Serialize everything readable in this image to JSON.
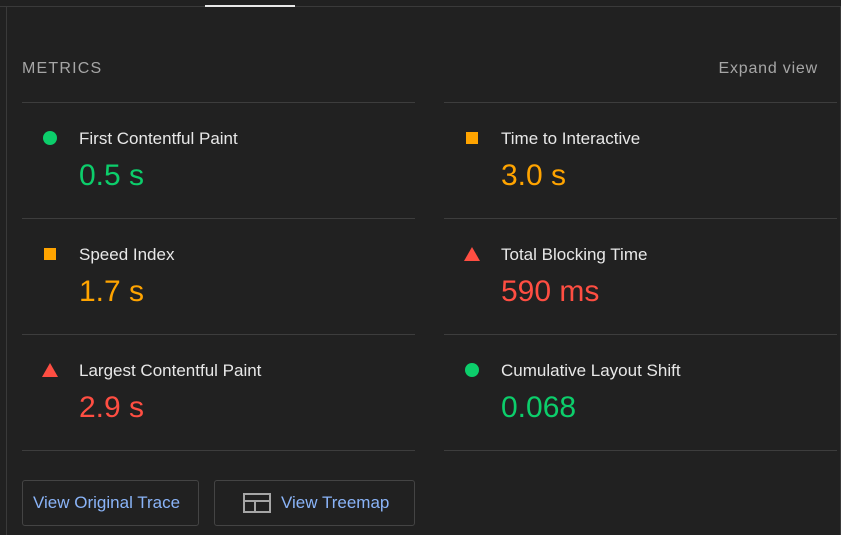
{
  "header": {
    "title": "METRICS",
    "expand_label": "Expand view"
  },
  "metrics": [
    {
      "title": "First Contentful Paint",
      "value": "0.5 s",
      "rating": "good"
    },
    {
      "title": "Time to Interactive",
      "value": "3.0 s",
      "rating": "average"
    },
    {
      "title": "Speed Index",
      "value": "1.7 s",
      "rating": "average"
    },
    {
      "title": "Total Blocking Time",
      "value": "590 ms",
      "rating": "fail"
    },
    {
      "title": "Largest Contentful Paint",
      "value": "2.9 s",
      "rating": "fail"
    },
    {
      "title": "Cumulative Layout Shift",
      "value": "0.068",
      "rating": "good"
    }
  ],
  "buttons": {
    "view_trace": "View Original Trace",
    "view_treemap": "View Treemap",
    "treemap_icon": "treemap-icon"
  },
  "colors": {
    "good": "#0cce6b",
    "average": "#ffa400",
    "fail": "#ff4e42",
    "link": "#8ab4f8"
  }
}
